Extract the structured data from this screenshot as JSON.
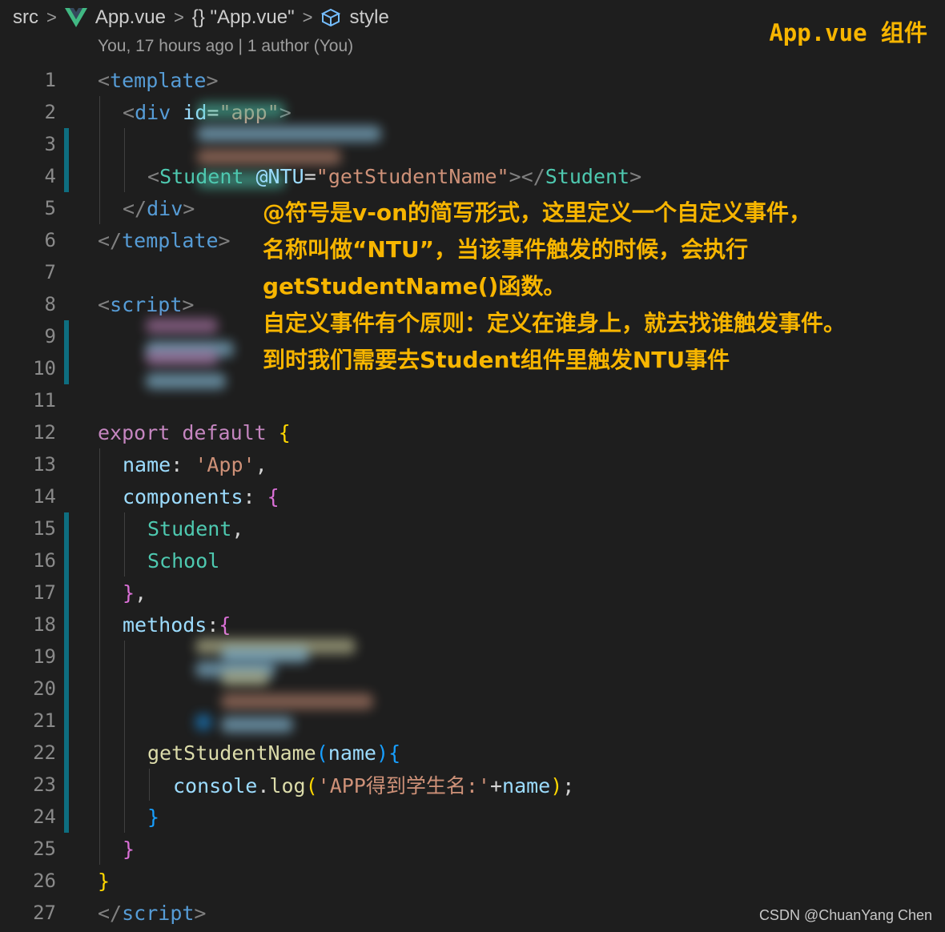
{
  "breadcrumb": {
    "items": [
      "src",
      "App.vue",
      "{} \"App.vue\"",
      "style"
    ],
    "file_icon": "vue-logo-icon",
    "style_icon": "cube-icon"
  },
  "codelens": "You, 17 hours ago | 1 author (You)",
  "title_note": "App.vue 组件",
  "line_numbers": [
    "1",
    "2",
    "3",
    "4",
    "5",
    "6",
    "7",
    "8",
    "9",
    "10",
    "11",
    "12",
    "13",
    "14",
    "15",
    "16",
    "17",
    "18",
    "19",
    "20",
    "21",
    "22",
    "23",
    "24",
    "25",
    "26",
    "27"
  ],
  "code": {
    "l1_tag": "template",
    "l2_tag": "div",
    "l2_attr": "id",
    "l2_val": "\"app\"",
    "l4_comp": "Student",
    "l4_attr": "@NTU",
    "l4_val": "\"getStudentName\"",
    "l4_close": "Student",
    "l5_tag": "div",
    "l6_tag": "template",
    "l8_tag": "script",
    "l12_kw1": "export",
    "l12_kw2": "default",
    "l13_prop": "name",
    "l13_val": "'App'",
    "l14_prop": "components",
    "l15_comp": "Student",
    "l16_comp": "School",
    "l18_prop": "methods",
    "l22_fn": "getStudentName",
    "l22_param": "name",
    "l23_obj": "console",
    "l23_fn": "log",
    "l23_str": "'APP得到学生名:'",
    "l23_var": "name",
    "l27_tag": "script"
  },
  "annotation": [
    "@符号是v-on的简写形式，这里定义一个自定义事件，",
    "名称叫做“NTU”，当该事件触发的时候，会执行",
    "getStudentName()函数。",
    "自定义事件有个原则：定义在谁身上，就去找谁触发事件。",
    "到时我们需要去Student组件里触发NTU事件"
  ],
  "watermark": "CSDN @ChuanYang Chen",
  "colors": {
    "background": "#1e1e1e",
    "annotation": "#f7b500",
    "tag": "#569cd6",
    "component": "#4ec9b0",
    "string": "#ce9178",
    "keyword": "#c586c0",
    "property": "#9cdcfe",
    "function": "#dcdcaa",
    "gutter_modified": "#0e6e80"
  }
}
